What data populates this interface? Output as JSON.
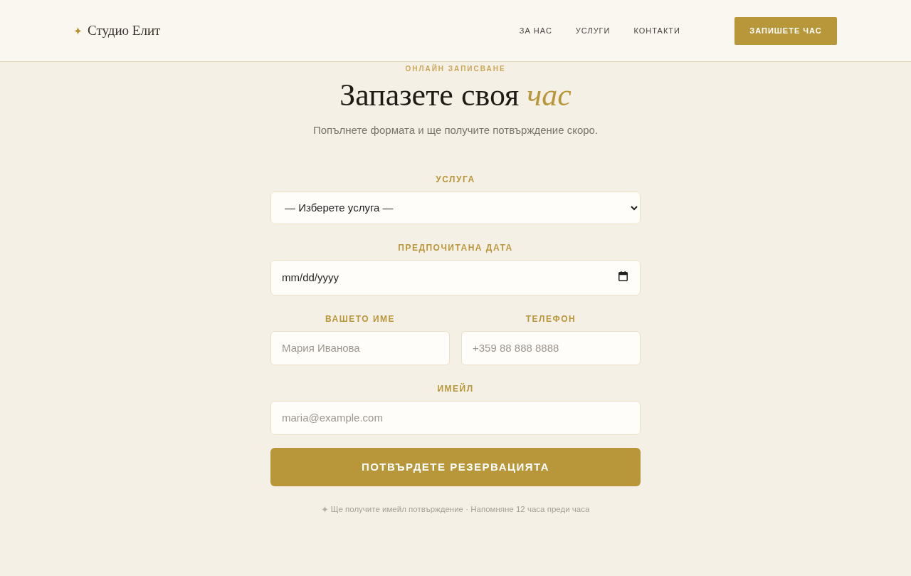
{
  "header": {
    "logo": "Студио Елит",
    "nav": [
      "ЗА НАС",
      "УСЛУГИ",
      "КОНТАКТИ"
    ],
    "cta": "ЗАПИШЕТЕ ЧАС"
  },
  "hero": {
    "eyebrow": "ОНЛАЙН ЗАПИСВАНЕ",
    "title": "Запазете своя *час*",
    "subtitle": "Попълнете формата и ще получите потвърждение скоро."
  },
  "form": {
    "rows": [
      {
        "fields": [
          {
            "kind": "select",
            "label": "УСЛУГА",
            "value": "— Изберете услуга —"
          }
        ]
      },
      {
        "fields": [
          {
            "kind": "date",
            "label": "ПРЕДПОЧИТАНА ДАТА",
            "placeholder": "mm/dd/yyyy"
          }
        ]
      },
      {
        "fields": [
          {
            "kind": "text",
            "label": "ВАШЕТО ИМЕ",
            "placeholder": "Мария Иванова"
          },
          {
            "kind": "text",
            "label": "ТЕЛЕФОН",
            "placeholder": "+359 88 888 8888"
          }
        ]
      },
      {
        "fields": [
          {
            "kind": "text",
            "label": "ИМЕЙЛ",
            "placeholder": "maria@example.com"
          }
        ]
      }
    ],
    "submit": "ПОТВЪРДЕТЕ РЕЗЕРВАЦИЯТА",
    "note": "Ще получите имейл потвърждение · Напомняне 12 часа преди часа"
  }
}
